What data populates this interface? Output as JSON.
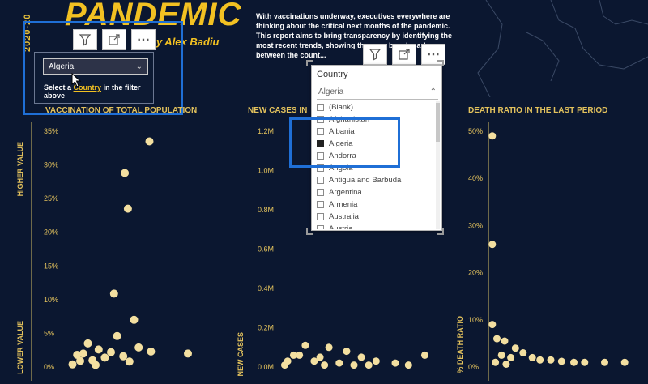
{
  "header": {
    "year_vertical": "2020-20",
    "title": "PANDEMIC",
    "author": "by Alex Badiu",
    "intro": "With vaccinations underway, executives everywhere are thinking about the critical next months of the pandemic. This report aims to bring transparency by identifying the most recent trends, showing the ma... benchmark between the count..."
  },
  "slicer": {
    "selected": "Algeria",
    "hint_prefix": "Select a ",
    "hint_link": "Country",
    "hint_suffix": " in the filter above"
  },
  "toolbar_icons": [
    "filter-icon",
    "focus-mode-icon",
    "more-options-icon"
  ],
  "country_dropdown": {
    "header": "Country",
    "search_value": "Algeria",
    "items": [
      {
        "label": "(Blank)",
        "checked": false
      },
      {
        "label": "Afghanistan",
        "checked": false
      },
      {
        "label": "Albania",
        "checked": false
      },
      {
        "label": "Algeria",
        "checked": true
      },
      {
        "label": "Andorra",
        "checked": false
      },
      {
        "label": "Angola",
        "checked": false
      },
      {
        "label": "Antigua and Barbuda",
        "checked": false
      },
      {
        "label": "Argentina",
        "checked": false
      },
      {
        "label": "Armenia",
        "checked": false
      },
      {
        "label": "Australia",
        "checked": false
      },
      {
        "label": "Austria",
        "checked": false
      }
    ]
  },
  "colors": {
    "background": "#0b1730",
    "accent_yellow": "#f2c122",
    "dot_fill": "#f3dfa0",
    "highlight_blue": "#1f6fd6"
  },
  "chart_data": [
    {
      "type": "scatter",
      "title": "VACCINATION OF TOTAL POPULATION",
      "ylabel_top": "HIGHER VALUE",
      "ylabel_bottom": "LOWER VALUE",
      "y_ticks": [
        "35%",
        "30%",
        "25%",
        "20%",
        "15%",
        "10%",
        "5%",
        "0%"
      ],
      "ylim": [
        0,
        35
      ],
      "points": [
        {
          "x": 0.55,
          "y": 33.5
        },
        {
          "x": 0.39,
          "y": 28.8
        },
        {
          "x": 0.41,
          "y": 23.5
        },
        {
          "x": 0.32,
          "y": 10.9
        },
        {
          "x": 0.45,
          "y": 7.0
        },
        {
          "x": 0.34,
          "y": 4.6
        },
        {
          "x": 0.15,
          "y": 3.5
        },
        {
          "x": 0.22,
          "y": 2.6
        },
        {
          "x": 0.3,
          "y": 2.2
        },
        {
          "x": 0.38,
          "y": 1.6
        },
        {
          "x": 0.26,
          "y": 1.4
        },
        {
          "x": 0.18,
          "y": 1.0
        },
        {
          "x": 0.1,
          "y": 0.9
        },
        {
          "x": 0.42,
          "y": 0.8
        },
        {
          "x": 0.48,
          "y": 2.9
        },
        {
          "x": 0.56,
          "y": 2.3
        },
        {
          "x": 0.8,
          "y": 2.0
        },
        {
          "x": 0.05,
          "y": 0.4
        },
        {
          "x": 0.12,
          "y": 2.0
        },
        {
          "x": 0.08,
          "y": 1.8
        },
        {
          "x": 0.2,
          "y": 0.3
        }
      ]
    },
    {
      "type": "scatter",
      "title": "NEW CASES IN",
      "ylabel_bottom": "NEW CASES",
      "y_ticks": [
        "1.2M",
        "1.0M",
        "0.8M",
        "0.6M",
        "0.4M",
        "0.2M",
        "0.0M"
      ],
      "ylim": [
        0,
        1.2
      ],
      "points": [
        {
          "x": 0.17,
          "y": 0.11
        },
        {
          "x": 0.33,
          "y": 0.1
        },
        {
          "x": 0.45,
          "y": 0.08
        },
        {
          "x": 0.09,
          "y": 0.06
        },
        {
          "x": 0.13,
          "y": 0.06
        },
        {
          "x": 0.55,
          "y": 0.05
        },
        {
          "x": 0.27,
          "y": 0.05
        },
        {
          "x": 0.05,
          "y": 0.03
        },
        {
          "x": 0.23,
          "y": 0.03
        },
        {
          "x": 0.4,
          "y": 0.02
        },
        {
          "x": 0.65,
          "y": 0.03
        },
        {
          "x": 0.78,
          "y": 0.02
        },
        {
          "x": 0.87,
          "y": 0.01
        },
        {
          "x": 0.98,
          "y": 0.06
        },
        {
          "x": 0.3,
          "y": 0.01
        },
        {
          "x": 0.5,
          "y": 0.01
        },
        {
          "x": 0.03,
          "y": 0.01
        },
        {
          "x": 0.6,
          "y": 0.01
        }
      ]
    },
    {
      "type": "scatter",
      "title": "DEATH RATIO IN THE LAST PERIOD",
      "ylabel_bottom": "% DEATH RATIO",
      "y_ticks": [
        "50%",
        "40%",
        "30%",
        "20%",
        "10%",
        "0%"
      ],
      "ylim": [
        0,
        50
      ],
      "points": [
        {
          "x": 0.02,
          "y": 49.0
        },
        {
          "x": 0.02,
          "y": 26.0
        },
        {
          "x": 0.02,
          "y": 9.0
        },
        {
          "x": 0.05,
          "y": 6.0
        },
        {
          "x": 0.1,
          "y": 5.5
        },
        {
          "x": 0.17,
          "y": 4.0
        },
        {
          "x": 0.08,
          "y": 2.5
        },
        {
          "x": 0.14,
          "y": 2.0
        },
        {
          "x": 0.22,
          "y": 3.0
        },
        {
          "x": 0.28,
          "y": 2.0
        },
        {
          "x": 0.33,
          "y": 1.5
        },
        {
          "x": 0.4,
          "y": 1.5
        },
        {
          "x": 0.47,
          "y": 1.2
        },
        {
          "x": 0.55,
          "y": 1.0
        },
        {
          "x": 0.62,
          "y": 1.0
        },
        {
          "x": 0.75,
          "y": 1.0
        },
        {
          "x": 0.88,
          "y": 1.0
        },
        {
          "x": 0.04,
          "y": 1.0
        },
        {
          "x": 0.11,
          "y": 0.6
        }
      ]
    }
  ]
}
